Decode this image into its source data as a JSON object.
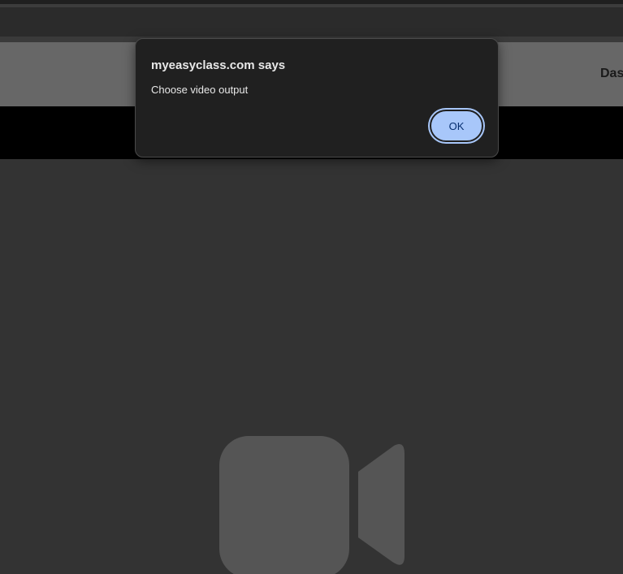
{
  "header": {
    "nav_link_label": "Das"
  },
  "dialog": {
    "title": "myeasyclass.com says",
    "message": "Choose video output",
    "ok_label": "OK"
  },
  "video": {
    "placeholder_icon": "video-camera-icon"
  },
  "colors": {
    "page_background": "#333333",
    "header_background": "#676767",
    "dialog_background": "#202020",
    "button_background": "#a8c7fa",
    "button_text": "#062e6f",
    "icon_fill": "#555555"
  }
}
